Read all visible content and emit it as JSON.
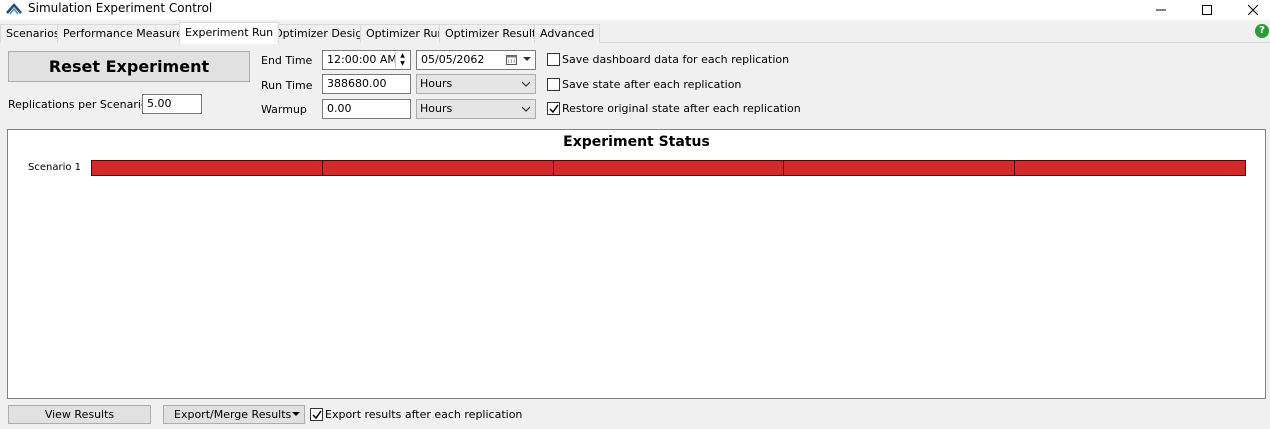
{
  "window": {
    "title": "Simulation Experiment Control",
    "minimize_glyph": "—",
    "close_glyph": "✕"
  },
  "tabs": [
    {
      "label": "Scenarios",
      "active": false
    },
    {
      "label": "Performance Measures",
      "active": false
    },
    {
      "label": "Experiment Run",
      "active": true
    },
    {
      "label": "Optimizer Design",
      "active": false
    },
    {
      "label": "Optimizer Run",
      "active": false
    },
    {
      "label": "Optimizer Results",
      "active": false
    },
    {
      "label": "Advanced",
      "active": false
    }
  ],
  "help_icon": {
    "glyph": "?",
    "color": "#2a9d3a"
  },
  "controls": {
    "reset_button": "Reset Experiment",
    "replications_label": "Replications per Scenario",
    "replications_value": "5.00",
    "end_time_label": "End Time",
    "end_time_value": "12:00:00 AM",
    "end_date_value": "05/05/2062",
    "run_time_label": "Run Time",
    "run_time_value": "388680.00",
    "run_time_units": "Hours",
    "warmup_label": "Warmup",
    "warmup_value": "0.00",
    "warmup_units": "Hours"
  },
  "options": {
    "save_dashboard": {
      "label": "Save dashboard data for each replication",
      "checked": false
    },
    "save_state": {
      "label": "Save state after each replication",
      "checked": false
    },
    "restore_state": {
      "label": "Restore original state after each replication",
      "checked": true
    }
  },
  "status": {
    "title": "Experiment Status",
    "scenarios": [
      {
        "label": "Scenario 1",
        "replications": 5,
        "color": "#d02a2a"
      }
    ]
  },
  "footer": {
    "view_results": "View Results",
    "export_merge": "Export/Merge Results",
    "export_after": {
      "label": "Export results after each replication",
      "checked": true
    }
  }
}
